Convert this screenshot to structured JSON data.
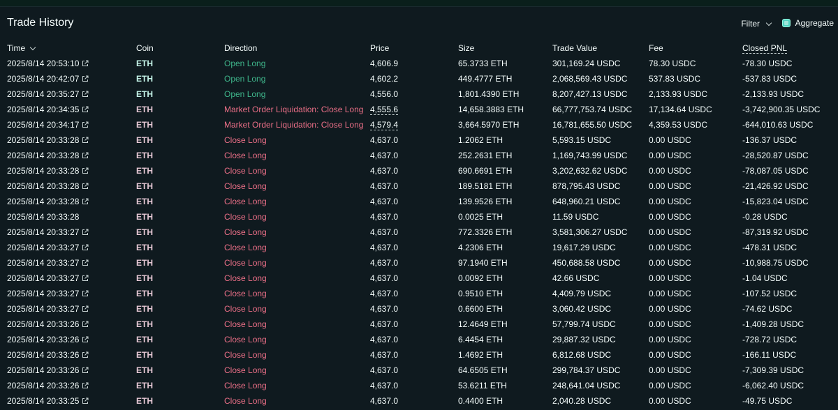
{
  "header": {
    "title": "Trade History",
    "filter_label": "Filter",
    "aggregate_label": "Aggregate",
    "aggregate_checked": true
  },
  "columns": {
    "time": "Time",
    "coin": "Coin",
    "direction": "Direction",
    "price": "Price",
    "size": "Size",
    "trade_value": "Trade Value",
    "fee": "Fee",
    "closed_pnl": "Closed PNL"
  },
  "colors": {
    "open": "#3fb68b",
    "close": "#ed7088",
    "background": "#0f1a1f",
    "accent": "#50d2c1"
  },
  "rows": [
    {
      "time": "2025/8/14 20:53:10",
      "link": true,
      "coin": "ETH",
      "direction": "Open Long",
      "side": "open",
      "price": "4,606.9",
      "price_dashed": false,
      "size": "65.3733 ETH",
      "value": "301,169.24 USDC",
      "fee": "78.30 USDC",
      "pnl": "-78.30 USDC"
    },
    {
      "time": "2025/8/14 20:42:07",
      "link": true,
      "coin": "ETH",
      "direction": "Open Long",
      "side": "open",
      "price": "4,602.2",
      "price_dashed": false,
      "size": "449.4777 ETH",
      "value": "2,068,569.43 USDC",
      "fee": "537.83 USDC",
      "pnl": "-537.83 USDC"
    },
    {
      "time": "2025/8/14 20:35:27",
      "link": true,
      "coin": "ETH",
      "direction": "Open Long",
      "side": "open",
      "price": "4,556.0",
      "price_dashed": false,
      "size": "1,801.4390 ETH",
      "value": "8,207,427.13 USDC",
      "fee": "2,133.93 USDC",
      "pnl": "-2,133.93 USDC"
    },
    {
      "time": "2025/8/14 20:34:35",
      "link": true,
      "coin": "ETH",
      "direction": "Market Order Liquidation: Close Long",
      "side": "close",
      "price": "4,555.6",
      "price_dashed": true,
      "size": "14,658.3883 ETH",
      "value": "66,777,753.74 USDC",
      "fee": "17,134.64 USDC",
      "pnl": "-3,742,900.35 USDC"
    },
    {
      "time": "2025/8/14 20:34:17",
      "link": true,
      "coin": "ETH",
      "direction": "Market Order Liquidation: Close Long",
      "side": "close",
      "price": "4,579.4",
      "price_dashed": true,
      "size": "3,664.5970 ETH",
      "value": "16,781,655.50 USDC",
      "fee": "4,359.53 USDC",
      "pnl": "-644,010.63 USDC"
    },
    {
      "time": "2025/8/14 20:33:28",
      "link": true,
      "coin": "ETH",
      "direction": "Close Long",
      "side": "close",
      "price": "4,637.0",
      "price_dashed": false,
      "size": "1.2062 ETH",
      "value": "5,593.15 USDC",
      "fee": "0.00 USDC",
      "pnl": "-136.37 USDC"
    },
    {
      "time": "2025/8/14 20:33:28",
      "link": true,
      "coin": "ETH",
      "direction": "Close Long",
      "side": "close",
      "price": "4,637.0",
      "price_dashed": false,
      "size": "252.2631 ETH",
      "value": "1,169,743.99 USDC",
      "fee": "0.00 USDC",
      "pnl": "-28,520.87 USDC"
    },
    {
      "time": "2025/8/14 20:33:28",
      "link": true,
      "coin": "ETH",
      "direction": "Close Long",
      "side": "close",
      "price": "4,637.0",
      "price_dashed": false,
      "size": "690.6691 ETH",
      "value": "3,202,632.62 USDC",
      "fee": "0.00 USDC",
      "pnl": "-78,087.05 USDC"
    },
    {
      "time": "2025/8/14 20:33:28",
      "link": true,
      "coin": "ETH",
      "direction": "Close Long",
      "side": "close",
      "price": "4,637.0",
      "price_dashed": false,
      "size": "189.5181 ETH",
      "value": "878,795.43 USDC",
      "fee": "0.00 USDC",
      "pnl": "-21,426.92 USDC"
    },
    {
      "time": "2025/8/14 20:33:28",
      "link": true,
      "coin": "ETH",
      "direction": "Close Long",
      "side": "close",
      "price": "4,637.0",
      "price_dashed": false,
      "size": "139.9526 ETH",
      "value": "648,960.21 USDC",
      "fee": "0.00 USDC",
      "pnl": "-15,823.04 USDC"
    },
    {
      "time": "2025/8/14 20:33:28",
      "link": false,
      "coin": "ETH",
      "direction": "Close Long",
      "side": "close",
      "price": "4,637.0",
      "price_dashed": false,
      "size": "0.0025 ETH",
      "value": "11.59 USDC",
      "fee": "0.00 USDC",
      "pnl": "-0.28 USDC"
    },
    {
      "time": "2025/8/14 20:33:27",
      "link": true,
      "coin": "ETH",
      "direction": "Close Long",
      "side": "close",
      "price": "4,637.0",
      "price_dashed": false,
      "size": "772.3326 ETH",
      "value": "3,581,306.27 USDC",
      "fee": "0.00 USDC",
      "pnl": "-87,319.92 USDC"
    },
    {
      "time": "2025/8/14 20:33:27",
      "link": true,
      "coin": "ETH",
      "direction": "Close Long",
      "side": "close",
      "price": "4,637.0",
      "price_dashed": false,
      "size": "4.2306 ETH",
      "value": "19,617.29 USDC",
      "fee": "0.00 USDC",
      "pnl": "-478.31 USDC"
    },
    {
      "time": "2025/8/14 20:33:27",
      "link": true,
      "coin": "ETH",
      "direction": "Close Long",
      "side": "close",
      "price": "4,637.0",
      "price_dashed": false,
      "size": "97.1940 ETH",
      "value": "450,688.58 USDC",
      "fee": "0.00 USDC",
      "pnl": "-10,988.75 USDC"
    },
    {
      "time": "2025/8/14 20:33:27",
      "link": true,
      "coin": "ETH",
      "direction": "Close Long",
      "side": "close",
      "price": "4,637.0",
      "price_dashed": false,
      "size": "0.0092 ETH",
      "value": "42.66 USDC",
      "fee": "0.00 USDC",
      "pnl": "-1.04 USDC"
    },
    {
      "time": "2025/8/14 20:33:27",
      "link": true,
      "coin": "ETH",
      "direction": "Close Long",
      "side": "close",
      "price": "4,637.0",
      "price_dashed": false,
      "size": "0.9510 ETH",
      "value": "4,409.79 USDC",
      "fee": "0.00 USDC",
      "pnl": "-107.52 USDC"
    },
    {
      "time": "2025/8/14 20:33:27",
      "link": true,
      "coin": "ETH",
      "direction": "Close Long",
      "side": "close",
      "price": "4,637.0",
      "price_dashed": false,
      "size": "0.6600 ETH",
      "value": "3,060.42 USDC",
      "fee": "0.00 USDC",
      "pnl": "-74.62 USDC"
    },
    {
      "time": "2025/8/14 20:33:26",
      "link": true,
      "coin": "ETH",
      "direction": "Close Long",
      "side": "close",
      "price": "4,637.0",
      "price_dashed": false,
      "size": "12.4649 ETH",
      "value": "57,799.74 USDC",
      "fee": "0.00 USDC",
      "pnl": "-1,409.28 USDC"
    },
    {
      "time": "2025/8/14 20:33:26",
      "link": true,
      "coin": "ETH",
      "direction": "Close Long",
      "side": "close",
      "price": "4,637.0",
      "price_dashed": false,
      "size": "6.4454 ETH",
      "value": "29,887.32 USDC",
      "fee": "0.00 USDC",
      "pnl": "-728.72 USDC"
    },
    {
      "time": "2025/8/14 20:33:26",
      "link": true,
      "coin": "ETH",
      "direction": "Close Long",
      "side": "close",
      "price": "4,637.0",
      "price_dashed": false,
      "size": "1.4692 ETH",
      "value": "6,812.68 USDC",
      "fee": "0.00 USDC",
      "pnl": "-166.11 USDC"
    },
    {
      "time": "2025/8/14 20:33:26",
      "link": true,
      "coin": "ETH",
      "direction": "Close Long",
      "side": "close",
      "price": "4,637.0",
      "price_dashed": false,
      "size": "64.6505 ETH",
      "value": "299,784.37 USDC",
      "fee": "0.00 USDC",
      "pnl": "-7,309.39 USDC"
    },
    {
      "time": "2025/8/14 20:33:26",
      "link": true,
      "coin": "ETH",
      "direction": "Close Long",
      "side": "close",
      "price": "4,637.0",
      "price_dashed": false,
      "size": "53.6211 ETH",
      "value": "248,641.04 USDC",
      "fee": "0.00 USDC",
      "pnl": "-6,062.40 USDC"
    },
    {
      "time": "2025/8/14 20:33:25",
      "link": true,
      "coin": "ETH",
      "direction": "Close Long",
      "side": "close",
      "price": "4,637.0",
      "price_dashed": false,
      "size": "0.4400 ETH",
      "value": "2,040.28 USDC",
      "fee": "0.00 USDC",
      "pnl": "-49.75 USDC"
    }
  ]
}
